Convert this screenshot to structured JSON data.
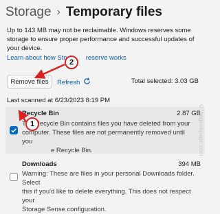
{
  "header": {
    "crumb": "Storage",
    "separator": "›",
    "title": "Temporary files"
  },
  "intro_text": "Up to 143 MB may not be reclaimable. Windows reserves some storage to ensure proper performance and successful updates of your device.",
  "learn_link": {
    "visible_text": "Learn about how Sto",
    "obscured_text": "reserve works"
  },
  "actions": {
    "remove_label": "Remove files",
    "refresh_label": "Refresh",
    "total_selected": "Total selected: 3.03 GB"
  },
  "last_scanned": "Last scanned at 6/23/2023 8:19 PM",
  "items": [
    {
      "name": "Recycle Bin",
      "size": "2.87 GB",
      "checked": true,
      "desc_lines": [
        "The Recycle Bin contains files you have deleted from your",
        "computer. These files are not permanently removed until you",
        "e Recycle Bin."
      ]
    },
    {
      "name": "Downloads",
      "size": "394 MB",
      "checked": false,
      "desc_lines": [
        "Warning: These are files in your personal Downloads folder. Select",
        "this if you'd like to delete everything. This does not respect your",
        "Storage Sense configuration."
      ]
    }
  ],
  "callouts": [
    "2",
    "1"
  ],
  "watermark": "©thegeekpage.com",
  "colors": {
    "accent": "#0067c0",
    "link": "#0b5cad",
    "callout": "#dd2222"
  },
  "icons": [
    "refresh-icon",
    "checkmark-icon",
    "arrow-icon"
  ]
}
